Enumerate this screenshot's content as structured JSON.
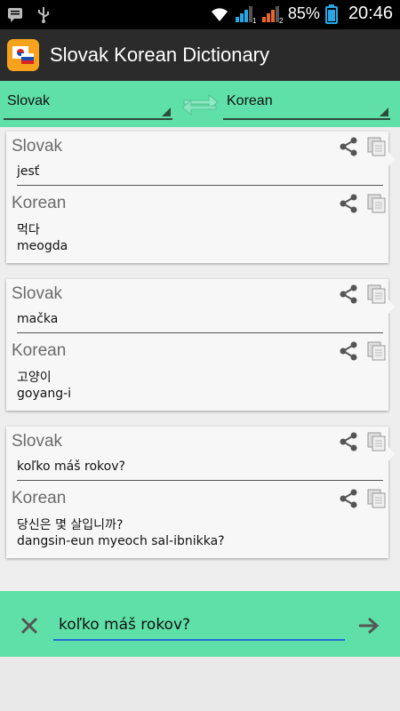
{
  "status": {
    "battery": "85%",
    "time": "20:46"
  },
  "app": {
    "title": "Slovak Korean Dictionary"
  },
  "langs": {
    "from": "Slovak",
    "to": "Korean"
  },
  "entries": [
    {
      "src_label": "Slovak",
      "src_text": "jesť",
      "tgt_label": "Korean",
      "tgt_text": "먹다",
      "tgt_roman": "meogda"
    },
    {
      "src_label": "Slovak",
      "src_text": "mačka",
      "tgt_label": "Korean",
      "tgt_text": "고양이",
      "tgt_roman": "goyang-i"
    },
    {
      "src_label": "Slovak",
      "src_text": "koľko máš rokov?",
      "tgt_label": "Korean",
      "tgt_text": "당신은 몇 살입니까?",
      "tgt_roman": "dangsin-eun myeoch sal-ibnikka?"
    }
  ],
  "input": {
    "value": "koľko máš rokov?"
  },
  "colors": {
    "accent": "#5fe0a8",
    "actionbar": "#2b2b2b",
    "underline": "#1f6fd6"
  }
}
